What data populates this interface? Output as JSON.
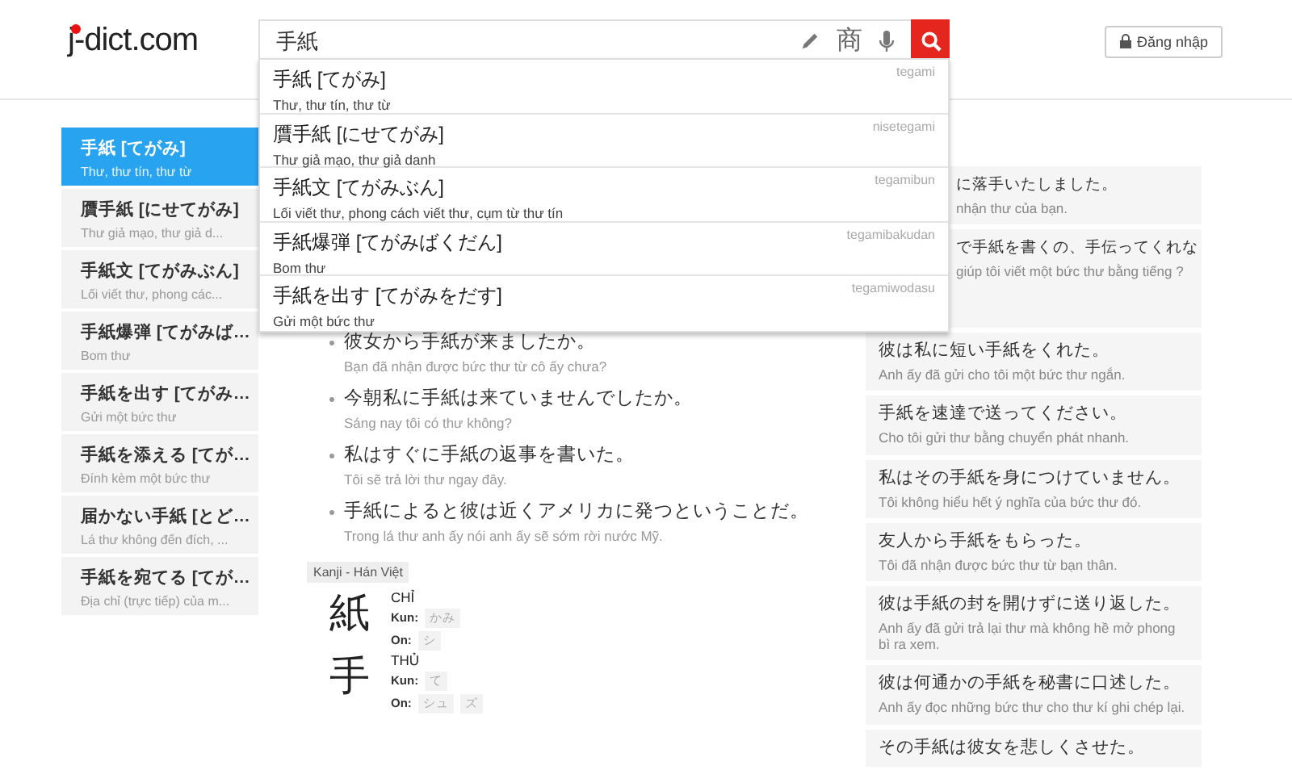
{
  "header": {
    "logo": "j-dict.com",
    "search": {
      "value": "手紙",
      "kanji_button": "商"
    },
    "login": "Đăng nhập"
  },
  "suggestions": [
    {
      "word": "手紙 [てがみ]",
      "meaning": "Thư, thư tín, thư từ",
      "romaji": "tegami"
    },
    {
      "word": "贋手紙 [にせてがみ]",
      "meaning": "Thư giả mạo, thư giả danh",
      "romaji": "nisetegami"
    },
    {
      "word": "手紙文 [てがみぶん]",
      "meaning": "Lối viết thư, phong cách viết thư, cụm từ thư tín",
      "romaji": "tegamibun"
    },
    {
      "word": "手紙爆弾 [てがみばくだん]",
      "meaning": "Bom thư",
      "romaji": "tegamibakudan"
    },
    {
      "word": "手紙を出す [てがみをだす]",
      "meaning": "Gửi một bức thư",
      "romaji": "tegamiwodasu"
    }
  ],
  "sidebar": {
    "items": [
      {
        "word": "手紙 [てがみ]",
        "meaning": "Thư, thư tín, thư từ",
        "selected": true
      },
      {
        "word": "贋手紙 [にせてがみ]",
        "meaning": "Thư giả mạo, thư giả d...",
        "selected": false
      },
      {
        "word": "手紙文 [てがみぶん]",
        "meaning": "Lối viết thư, phong các...",
        "selected": false
      },
      {
        "word": "手紙爆弾 [てがみば…",
        "meaning": "Bom thư",
        "selected": false
      },
      {
        "word": "手紙を出す [てがみ…",
        "meaning": "Gửi một bức thư",
        "selected": false
      },
      {
        "word": "手紙を添える [てが…",
        "meaning": "Đính kèm một bức thư",
        "selected": false
      },
      {
        "word": "届かない手紙 [とど…",
        "meaning": "Lá thư không đến đích, ...",
        "selected": false
      },
      {
        "word": "手紙を宛てる [てが…",
        "meaning": "Địa chỉ (trực tiếp) của m...",
        "selected": false
      }
    ]
  },
  "examples": [
    {
      "ja": "彼女から手紙が来ましたか。",
      "vi": "Bạn đã nhận được bức thư từ cô ấy chưa?"
    },
    {
      "ja": "今朝私に手紙は来ていませんでしたか。",
      "vi": "Sáng nay tôi có thư không?"
    },
    {
      "ja": "私はすぐに手紙の返事を書いた。",
      "vi": "Tôi sẽ trả lời thư ngay đây."
    },
    {
      "ja": "手紙によると彼は近くアメリカに発つということだ。",
      "vi": "Trong lá thư anh ấy nói anh ấy sẽ sớm rời nước Mỹ."
    }
  ],
  "kanji": {
    "heading": "Kanji - Hán Việt",
    "items": [
      {
        "char": "紙",
        "han_viet": "CHỈ",
        "kun_label": "Kun:",
        "kun": [
          "かみ"
        ],
        "on_label": "On:",
        "on": [
          "シ"
        ]
      },
      {
        "char": "手",
        "han_viet": "THỦ",
        "kun_label": "Kun:",
        "kun": [
          "て"
        ],
        "on_label": "On:",
        "on": [
          "シュ",
          "ズ"
        ]
      }
    ]
  },
  "sentences": [
    {
      "kind": "clipped",
      "ja": "に落手いたしました。",
      "vi": "nhận thư của bạn."
    },
    {
      "kind": "clipped",
      "ja": "で手紙を書くの、手伝ってくれな",
      "vi": "giúp tôi viết một bức thư bằng tiếng ?"
    },
    {
      "kind": "full",
      "ja": "彼は私に短い手紙をくれた。",
      "vi": "Anh ấy đã gửi cho tôi một bức thư ngắn."
    },
    {
      "kind": "full",
      "ja": "手紙を速達で送ってください。",
      "vi": "Cho tôi gửi thư bằng chuyển phát nhanh."
    },
    {
      "kind": "full",
      "ja": "私はその手紙を身につけていません。",
      "vi": "Tôi không hiểu hết ý nghĩa của bức thư đó."
    },
    {
      "kind": "full",
      "ja": "友人から手紙をもらった。",
      "vi": "Tôi đã nhận được bức thư từ bạn thân."
    },
    {
      "kind": "full",
      "ja": "彼は手紙の封を開けずに送り返した。",
      "vi": "Anh ấy đã gửi trả lại thư mà không hề mở phong bì ra xem."
    },
    {
      "kind": "full",
      "ja": "彼は何通かの手紙を秘書に口述した。",
      "vi": "Anh ấy đọc những bức thư cho thư kí ghi chép lại."
    },
    {
      "kind": "full",
      "ja": "その手紙は彼女を悲しくさせた。"
    }
  ]
}
